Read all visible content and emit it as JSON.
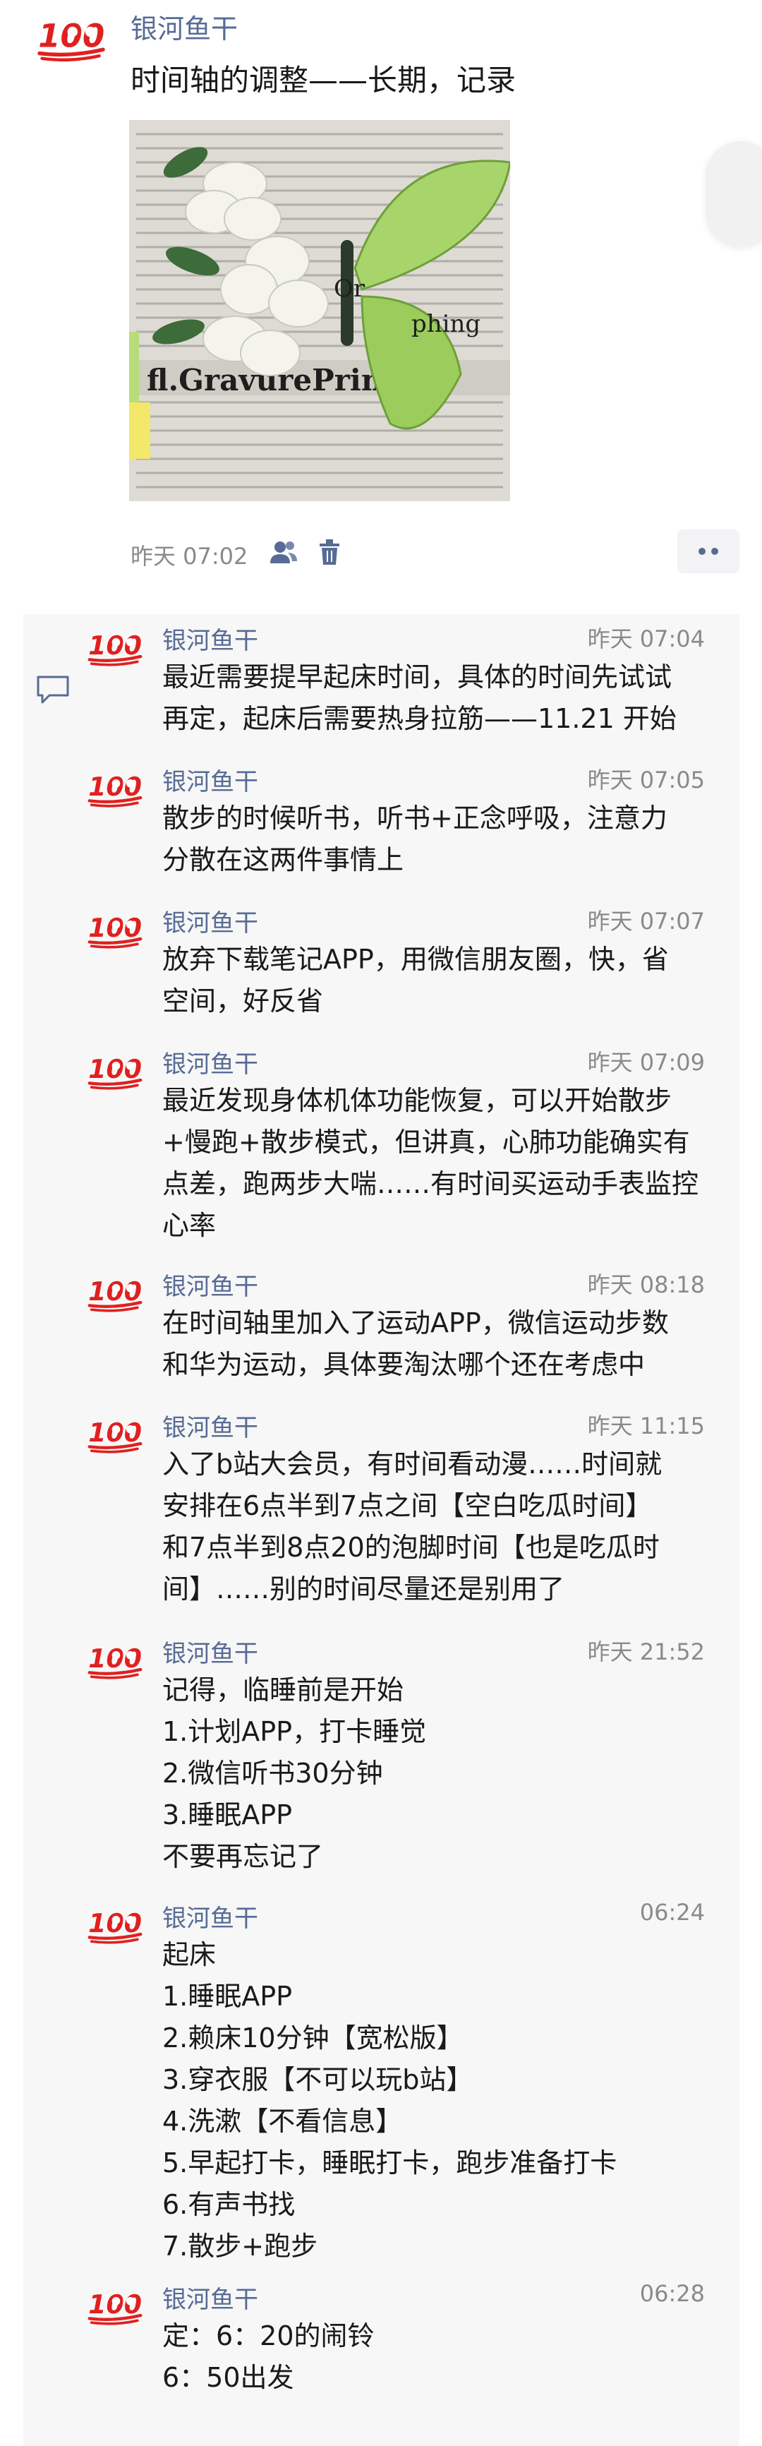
{
  "post": {
    "author": "银河鱼干",
    "text": "时间轴的调整——长期，记录",
    "time": "昨天 07:02",
    "image_caption": "fl.GravurePrint"
  },
  "comments": [
    {
      "name": "银河鱼干",
      "time": "昨天 07:04",
      "lines": [
        "最近需要提早起床时间，具体的时间先试试",
        "再定，起床后需要热身拉筋——11.21 开始"
      ]
    },
    {
      "name": "银河鱼干",
      "time": "昨天 07:05",
      "lines": [
        "散步的时候听书，听书+正念呼吸，注意力",
        "分散在这两件事情上"
      ]
    },
    {
      "name": "银河鱼干",
      "time": "昨天 07:07",
      "lines": [
        "放弃下载笔记APP，用微信朋友圈，快，省",
        "空间，好反省"
      ]
    },
    {
      "name": "银河鱼干",
      "time": "昨天 07:09",
      "lines": [
        "最近发现身体机体功能恢复，可以开始散步",
        "+慢跑+散步模式，但讲真，心肺功能确实有",
        "点差，跑两步大喘……有时间买运动手表监控",
        "心率"
      ]
    },
    {
      "name": "银河鱼干",
      "time": "昨天 08:18",
      "lines": [
        "在时间轴里加入了运动APP，微信运动步数",
        "和华为运动，具体要淘汰哪个还在考虑中"
      ]
    },
    {
      "name": "银河鱼干",
      "time": "昨天 11:15",
      "lines": [
        "入了b站大会员，有时间看动漫……时间就",
        "安排在6点半到7点之间【空白吃瓜时间】",
        "和7点半到8点20的泡脚时间【也是吃瓜时",
        "间】……别的时间尽量还是别用了"
      ]
    },
    {
      "name": "银河鱼干",
      "time": "昨天 21:52",
      "lines": [
        "记得，临睡前是开始",
        "1.计划APP，打卡睡觉",
        "2.微信听书30分钟",
        "3.睡眠APP",
        "不要再忘记了"
      ]
    },
    {
      "name": "银河鱼干",
      "time": "06:24",
      "lines": [
        "起床",
        "1.睡眠APP",
        "2.赖床10分钟【宽松版】",
        "3.穿衣服【不可以玩b站】",
        "4.洗漱【不看信息】",
        "5.早起打卡，睡眠打卡，跑步准备打卡",
        "6.有声书找",
        "7.散步+跑步"
      ]
    },
    {
      "name": "银河鱼干",
      "time": "06:28",
      "lines": [
        "定：6：20的闹铃",
        "6：50出发"
      ]
    }
  ]
}
